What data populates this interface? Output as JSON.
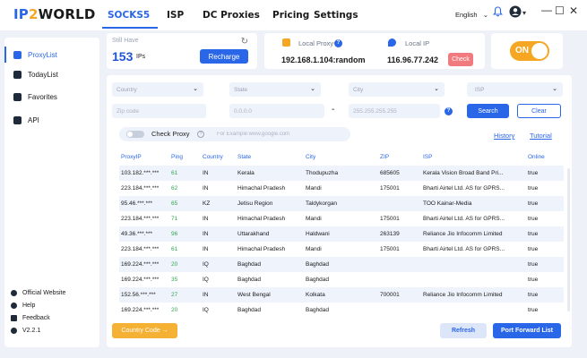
{
  "app": {
    "logo_ip": "IP",
    "logo_two": "2",
    "logo_world": "WORLD",
    "language": "English"
  },
  "nav": {
    "tabs": [
      "SOCKS5",
      "ISP",
      "DC Proxies",
      "Pricing",
      "Settings"
    ],
    "active": "SOCKS5"
  },
  "sidebar": {
    "items": [
      {
        "label": "ProxyList",
        "icon": "proxylist-icon",
        "active": true
      },
      {
        "label": "TodayList",
        "icon": "todaylist-icon",
        "active": false
      },
      {
        "label": "Favorites",
        "icon": "favorites-icon",
        "active": false
      },
      {
        "label": "API",
        "icon": "api-icon",
        "active": false
      }
    ],
    "footer": [
      {
        "label": "Official Website",
        "icon": "globe-icon"
      },
      {
        "label": "Help",
        "icon": "help-icon"
      },
      {
        "label": "Feedback",
        "icon": "feedback-icon"
      },
      {
        "label": "V2.2.1",
        "icon": "version-icon"
      }
    ]
  },
  "balance": {
    "label": "Still Have",
    "count": "153",
    "unit": "IPs",
    "recharge_label": "Recharge"
  },
  "local_proxy": {
    "label": "Local Proxy",
    "value": "192.168.1.104:random"
  },
  "local_ip": {
    "label": "Local IP",
    "value": "116.96.77.242",
    "check_label": "Check"
  },
  "power_toggle": {
    "label": "ON"
  },
  "filters": {
    "country_placeholder": "Country",
    "state_placeholder": "State",
    "city_placeholder": "City",
    "isp_placeholder": "ISP",
    "zip_placeholder": "Zip code",
    "ip_from_placeholder": "0.0.0.0",
    "ip_to_placeholder": "255.255.255.255",
    "search_label": "Search",
    "clear_label": "Clear"
  },
  "check_proxy": {
    "label": "Check Proxy",
    "input_placeholder": "For Example:www.google.com",
    "history_label": "History",
    "tutorial_label": "Tutorial"
  },
  "table": {
    "headers": [
      "ProxyIP",
      "Ping",
      "Country",
      "State",
      "City",
      "ZIP",
      "ISP",
      "Online"
    ],
    "rows": [
      [
        "103.182.***.***",
        "61",
        "IN",
        "Kerala",
        "Thodupuzha",
        "685605",
        "Kerala Vision Broad Band Pri...",
        "true"
      ],
      [
        "223.184.***.***",
        "62",
        "IN",
        "Himachal Pradesh",
        "Mandi",
        "175001",
        "Bharti Airtel Ltd. AS for GPRS...",
        "true"
      ],
      [
        "95.46.***.***",
        "65",
        "KZ",
        "Jetisu Region",
        "Taldykorgan",
        "",
        "TOO Kainar-Media",
        "true"
      ],
      [
        "223.184.***.***",
        "71",
        "IN",
        "Himachal Pradesh",
        "Mandi",
        "175001",
        "Bharti Airtel Ltd. AS for GPRS...",
        "true"
      ],
      [
        "49.36.***.***",
        "96",
        "IN",
        "Uttarakhand",
        "Haldwani",
        "263139",
        "Reliance Jio Infocomm Limited",
        "true"
      ],
      [
        "223.184.***.***",
        "61",
        "IN",
        "Himachal Pradesh",
        "Mandi",
        "175001",
        "Bharti Airtel Ltd. AS for GPRS...",
        "true"
      ],
      [
        "169.224.***.***",
        "20",
        "IQ",
        "Baghdad",
        "Baghdad",
        "",
        "",
        "true"
      ],
      [
        "169.224.***.***",
        "35",
        "IQ",
        "Baghdad",
        "Baghdad",
        "",
        "",
        "true"
      ],
      [
        "152.56.***.***",
        "27",
        "IN",
        "West Bengal",
        "Kolkata",
        "700001",
        "Reliance Jio Infocomm Limited",
        "true"
      ],
      [
        "169.224.***.***",
        "20",
        "IQ",
        "Baghdad",
        "Baghdad",
        "",
        "",
        "true"
      ]
    ]
  },
  "footer_buttons": {
    "country_code_label": "Country Code →",
    "refresh_label": "Refresh",
    "port_forward_label": "Port Forward List"
  },
  "colors": {
    "accent": "#2a66e8",
    "orange": "#f5a623",
    "danger": "#f07a7d",
    "ping_green": "#2fa84f"
  }
}
